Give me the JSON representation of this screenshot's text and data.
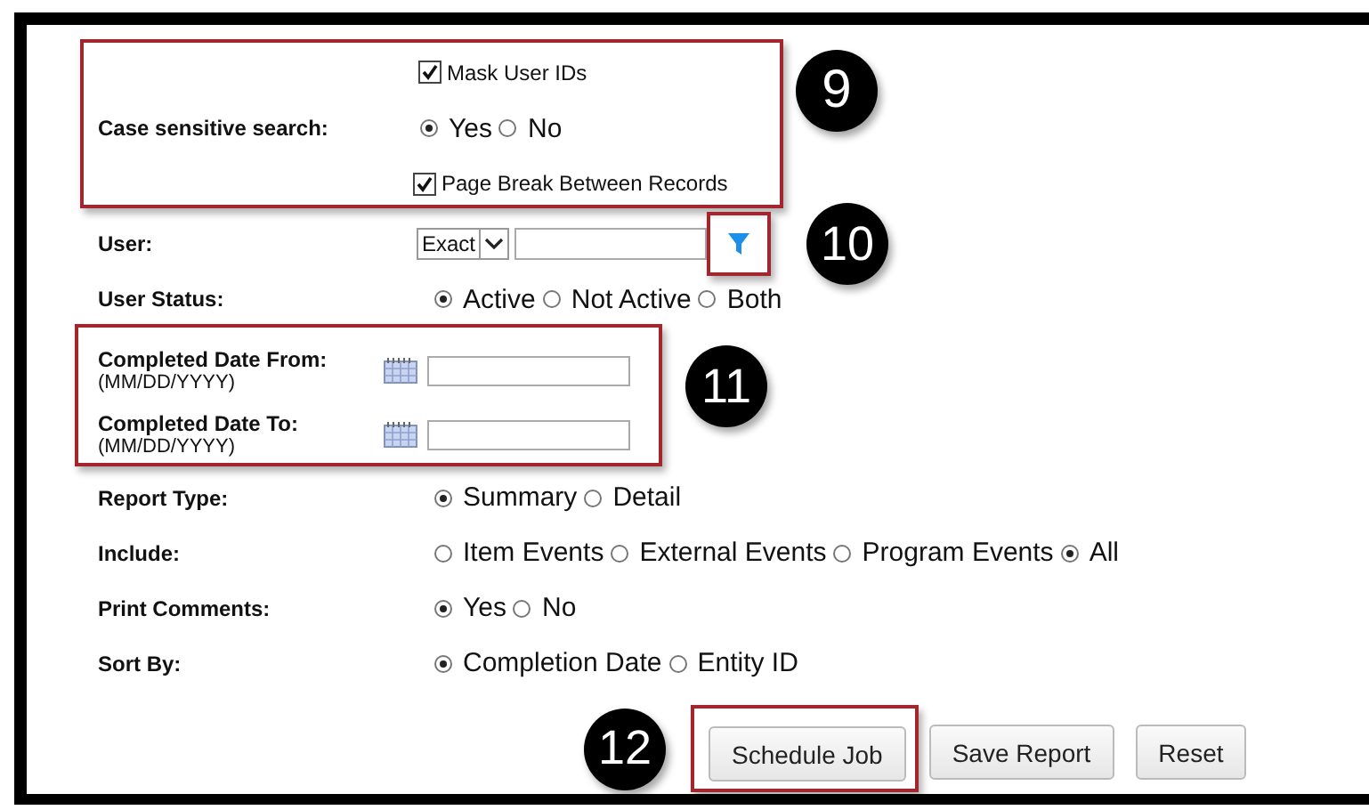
{
  "case_group": {
    "callout": "9",
    "mask_checkbox": {
      "label": "Mask User IDs",
      "checked": true
    },
    "label": "Case sensitive search:",
    "options": [
      {
        "label": "Yes",
        "selected": true
      },
      {
        "label": "No",
        "selected": false
      }
    ],
    "page_break_checkbox": {
      "label": "Page Break Between Records",
      "checked": true
    }
  },
  "user": {
    "label": "User:",
    "match_select": "Exact",
    "filter_callout": "10"
  },
  "user_status": {
    "label": "User Status:",
    "options": [
      {
        "label": "Active",
        "selected": true
      },
      {
        "label": "Not Active",
        "selected": false
      },
      {
        "label": "Both",
        "selected": false
      }
    ]
  },
  "date_group": {
    "callout": "11",
    "fields": [
      {
        "label": "Completed Date From:",
        "hint": "(MM/DD/YYYY)"
      },
      {
        "label": "Completed Date To:",
        "hint": "(MM/DD/YYYY)"
      }
    ]
  },
  "radio_rows": [
    {
      "label": "Report Type:",
      "options": [
        {
          "label": "Summary",
          "selected": true
        },
        {
          "label": "Detail",
          "selected": false
        }
      ]
    },
    {
      "label": "Include:",
      "options": [
        {
          "label": "Item Events",
          "selected": false
        },
        {
          "label": "External Events",
          "selected": false
        },
        {
          "label": "Program Events",
          "selected": false
        },
        {
          "label": "All",
          "selected": true
        }
      ]
    },
    {
      "label": "Print Comments:",
      "options": [
        {
          "label": "Yes",
          "selected": true
        },
        {
          "label": "No",
          "selected": false
        }
      ]
    },
    {
      "label": "Sort By:",
      "options": [
        {
          "label": "Completion Date",
          "selected": true
        },
        {
          "label": "Entity ID",
          "selected": false
        }
      ]
    }
  ],
  "buttons_callout": "12",
  "buttons": [
    {
      "label": "Schedule Job",
      "highlighted": true
    },
    {
      "label": "Save Report",
      "highlighted": false
    },
    {
      "label": "Reset",
      "highlighted": false
    }
  ]
}
